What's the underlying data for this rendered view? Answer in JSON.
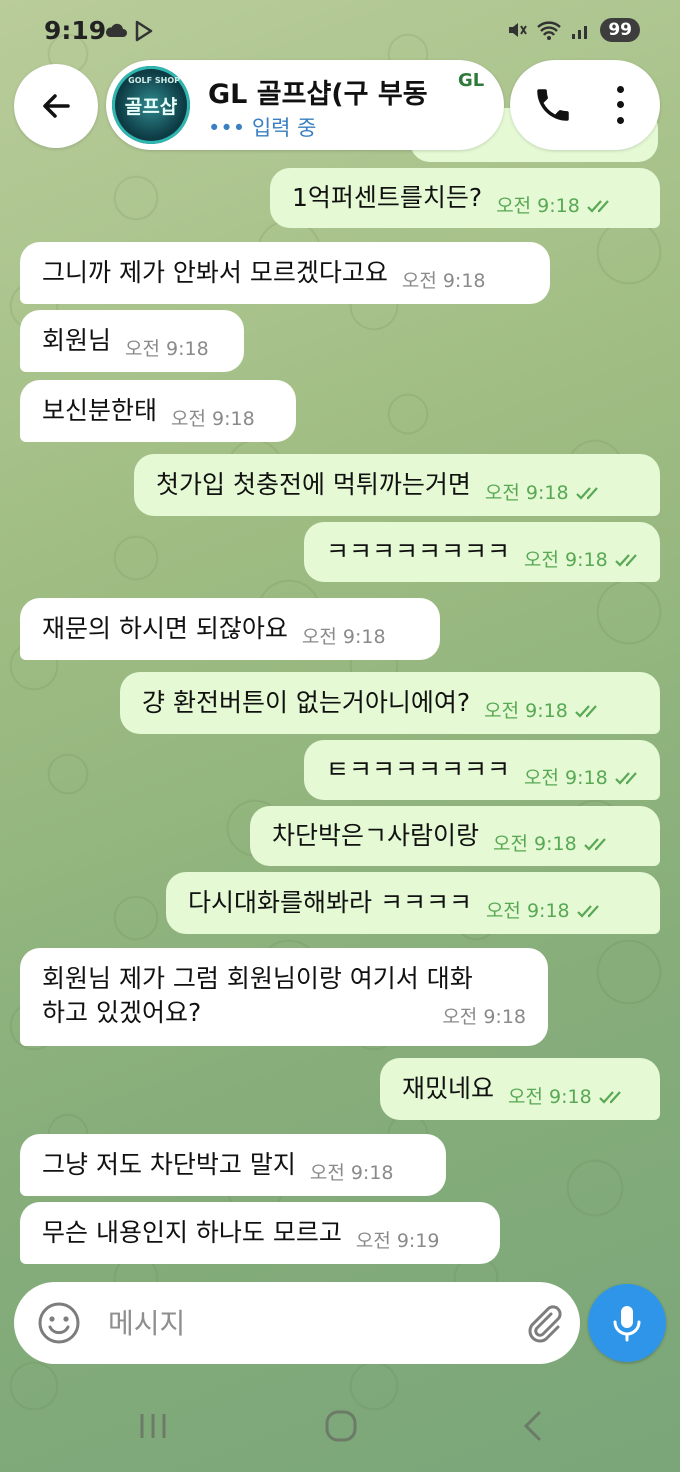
{
  "status_bar": {
    "time": "9:19",
    "battery": "99"
  },
  "header": {
    "title": "GL 골프샵(구 부동",
    "status": "••• 입력 중",
    "avatar_text": "골프샵",
    "avatar_small": "GOLF SHOP",
    "logo_text": "GL"
  },
  "messages": [
    {
      "direction": "out",
      "text": "1억퍼센트를치든?",
      "time": "오전 9:18"
    },
    {
      "direction": "in",
      "text": "그니까 제가 안봐서 모르겠다고요",
      "time": "오전 9:18"
    },
    {
      "direction": "in",
      "text": "회원님",
      "time": "오전 9:18"
    },
    {
      "direction": "in",
      "text": "보신분한태",
      "time": "오전 9:18"
    },
    {
      "direction": "out",
      "text": "첫가입 첫충전에 먹튀까는거면",
      "time": "오전 9:18"
    },
    {
      "direction": "out",
      "text": "ㅋㅋㅋㅋㅋㅋㅋㅋ",
      "time": "오전 9:18"
    },
    {
      "direction": "in",
      "text": "재문의 하시면 되잖아요",
      "time": "오전 9:18"
    },
    {
      "direction": "out",
      "text": "걍 환전버튼이 없는거아니에여?",
      "time": "오전 9:18"
    },
    {
      "direction": "out",
      "text": "ㅌㅋㅋㅋㅋㅋㅋㅋ",
      "time": "오전 9:18"
    },
    {
      "direction": "out",
      "text": "차단박은ㄱ사람이랑",
      "time": "오전 9:18"
    },
    {
      "direction": "out",
      "text": "다시대화를해봐라 ㅋㅋㅋㅋ",
      "time": "오전 9:18"
    },
    {
      "direction": "in",
      "text": "회원님 제가 그럼 회원님이랑 여기서 대화",
      "text2": "하고 있겠어요?",
      "time": "오전 9:18"
    },
    {
      "direction": "out",
      "text": "재밌네요",
      "time": "오전 9:18"
    },
    {
      "direction": "in",
      "text": "그냥 저도 차단박고 말지",
      "time": "오전 9:18"
    },
    {
      "direction": "in",
      "text": "무슨 내용인지 하나도 모르고",
      "time": "오전 9:19"
    }
  ],
  "input": {
    "placeholder": "메시지"
  },
  "colors": {
    "accent": "#2f95e8",
    "outgoing_bubble": "#e4f9d4",
    "incoming_bubble": "#ffffff",
    "read_check": "#59a854"
  }
}
